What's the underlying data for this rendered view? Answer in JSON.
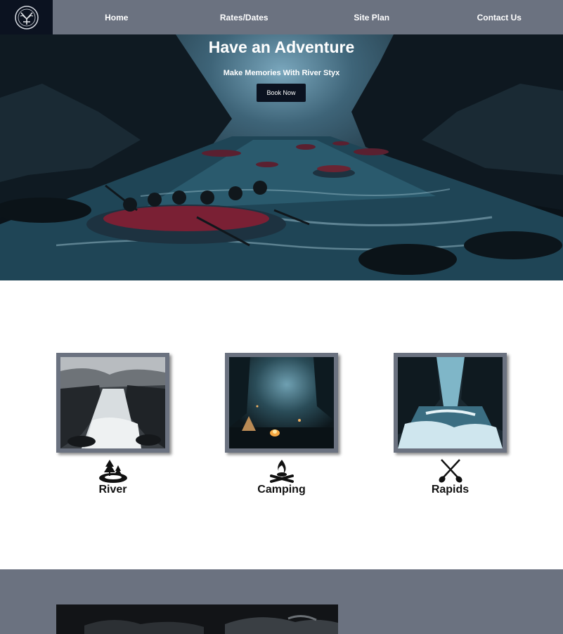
{
  "nav": {
    "logo_icon": "river-styx-emblem-icon",
    "links": [
      "Home",
      "Rates/Dates",
      "Site Plan",
      "Contact Us"
    ]
  },
  "hero": {
    "title": "Have an Adventure",
    "subtitle": "Make Memories With River Styx",
    "button_label": "Book Now"
  },
  "features": [
    {
      "label": "River",
      "icon": "tree-island-icon"
    },
    {
      "label": "Camping",
      "icon": "campfire-icon"
    },
    {
      "label": "Rapids",
      "icon": "crossed-paddles-icon"
    }
  ],
  "colors": {
    "nav_bg": "#6b7280",
    "logo_bg": "#0b1220",
    "button_bg": "#0b1220",
    "frame": "#6b7280"
  }
}
